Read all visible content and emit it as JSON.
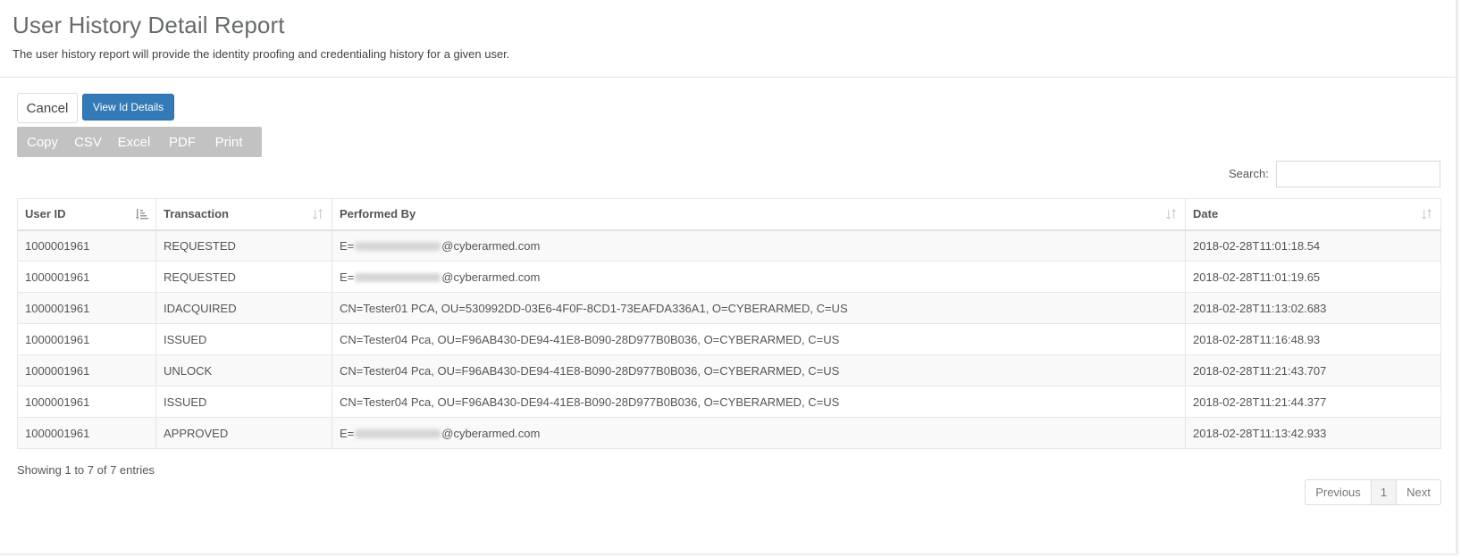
{
  "header": {
    "title": "User History Detail Report",
    "subtitle": "The user history report will provide the identity proofing and credentialing history for a given user."
  },
  "actions": {
    "cancel_label": "Cancel",
    "view_label": "View Id Details"
  },
  "export": {
    "buttons": [
      "Copy",
      "CSV",
      "Excel",
      "PDF",
      "Print"
    ]
  },
  "search": {
    "label": "Search:",
    "value": ""
  },
  "table": {
    "columns": [
      "User ID",
      "Transaction",
      "Performed By",
      "Date"
    ],
    "sorted_column": "User ID",
    "rows": [
      {
        "user_id": "1000001961",
        "transaction": "REQUESTED",
        "performed_by_prefix": "E=",
        "performed_by_suffix": "@cyberarmed.com",
        "performed_by_redacted": true,
        "date": "2018-02-28T11:01:18.54"
      },
      {
        "user_id": "1000001961",
        "transaction": "REQUESTED",
        "performed_by_prefix": "E=",
        "performed_by_suffix": "@cyberarmed.com",
        "performed_by_redacted": true,
        "date": "2018-02-28T11:01:19.65"
      },
      {
        "user_id": "1000001961",
        "transaction": "IDACQUIRED",
        "performed_by_prefix": "CN=Tester01 PCA, OU=530992DD-03E6-4F0F-8CD1-73EAFDA336A1, O=CYBERARMED, C=US",
        "performed_by_suffix": "",
        "performed_by_redacted": false,
        "date": "2018-02-28T11:13:02.683"
      },
      {
        "user_id": "1000001961",
        "transaction": "ISSUED",
        "performed_by_prefix": "CN=Tester04 Pca, OU=F96AB430-DE94-41E8-B090-28D977B0B036, O=CYBERARMED, C=US",
        "performed_by_suffix": "",
        "performed_by_redacted": false,
        "date": "2018-02-28T11:16:48.93"
      },
      {
        "user_id": "1000001961",
        "transaction": "UNLOCK",
        "performed_by_prefix": "CN=Tester04 Pca, OU=F96AB430-DE94-41E8-B090-28D977B0B036, O=CYBERARMED, C=US",
        "performed_by_suffix": "",
        "performed_by_redacted": false,
        "date": "2018-02-28T11:21:43.707"
      },
      {
        "user_id": "1000001961",
        "transaction": "ISSUED",
        "performed_by_prefix": "CN=Tester04 Pca, OU=F96AB430-DE94-41E8-B090-28D977B0B036, O=CYBERARMED, C=US",
        "performed_by_suffix": "",
        "performed_by_redacted": false,
        "date": "2018-02-28T11:21:44.377"
      },
      {
        "user_id": "1000001961",
        "transaction": "APPROVED",
        "performed_by_prefix": "E=",
        "performed_by_suffix": "@cyberarmed.com",
        "performed_by_redacted": true,
        "date": "2018-02-28T11:13:42.933"
      }
    ]
  },
  "footer": {
    "info": "Showing 1 to 7 of 7 entries",
    "pagination": {
      "previous_label": "Previous",
      "current_page": "1",
      "next_label": "Next"
    }
  },
  "colors": {
    "primary": "#337ab7",
    "export_bg": "#c2c2c2",
    "row_stripe": "#f9f9f9"
  },
  "icons": {
    "sort_active": "sort-amount-icon",
    "sort_inactive": "sort-both-icon"
  }
}
